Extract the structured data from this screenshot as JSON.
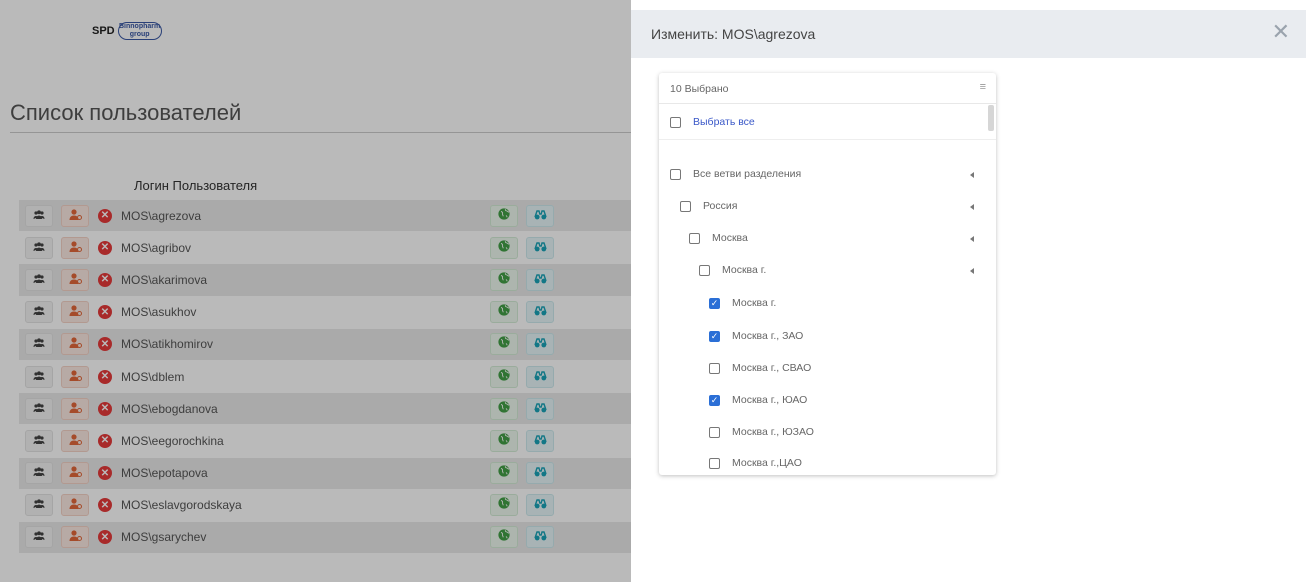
{
  "app": {
    "brand_text": "SPD",
    "brand_logo_text": "Binnopharm group"
  },
  "page": {
    "title": "Список пользователей",
    "column_header": "Логин Пользователя"
  },
  "users": [
    "MOS\\agrezova",
    "MOS\\agribov",
    "MOS\\akarimova",
    "MOS\\asukhov",
    "MOS\\atikhomirov",
    "MOS\\dblem",
    "MOS\\ebogdanova",
    "MOS\\eegorochkina",
    "MOS\\epotapova",
    "MOS\\eslavgorodskaya",
    "MOS\\gsarychev"
  ],
  "row_icons": [
    "users-icon",
    "user-icon",
    "delete-icon",
    "globe-icon",
    "binoculars-icon"
  ],
  "panel": {
    "title": "Изменить: MOS\\agrezova",
    "close_label": "✕"
  },
  "multiselect": {
    "count_text": "10 Выбрано",
    "menu_icon": "≡",
    "select_all": "Выбрать все",
    "options": [
      {
        "label": "Все ветви разделения",
        "checked": false,
        "level": 0,
        "expandable": true
      },
      {
        "label": "Россия",
        "checked": false,
        "level": 1,
        "expandable": true
      },
      {
        "label": "Москва",
        "checked": false,
        "level": 2,
        "expandable": true
      },
      {
        "label": "Москва г.",
        "checked": false,
        "level": 3,
        "expandable": true
      },
      {
        "label": "Москва г.",
        "checked": true,
        "level": 4,
        "expandable": false
      },
      {
        "label": "Москва г., ЗАО",
        "checked": true,
        "level": 4,
        "expandable": false
      },
      {
        "label": "Москва г., СВАО",
        "checked": false,
        "level": 4,
        "expandable": false
      },
      {
        "label": "Москва г., ЮАО",
        "checked": true,
        "level": 4,
        "expandable": false
      },
      {
        "label": "Москва г., ЮЗАО",
        "checked": false,
        "level": 4,
        "expandable": false
      },
      {
        "label": "Москва г.,ЦАО",
        "checked": false,
        "level": 4,
        "expandable": false
      }
    ]
  },
  "colors": {
    "accent_blue": "#2b6fd6",
    "delete_red": "#e63a3a",
    "user_orange": "#e2683a",
    "globe_green": "#43a047",
    "binoculars_teal": "#1aa3b8"
  }
}
